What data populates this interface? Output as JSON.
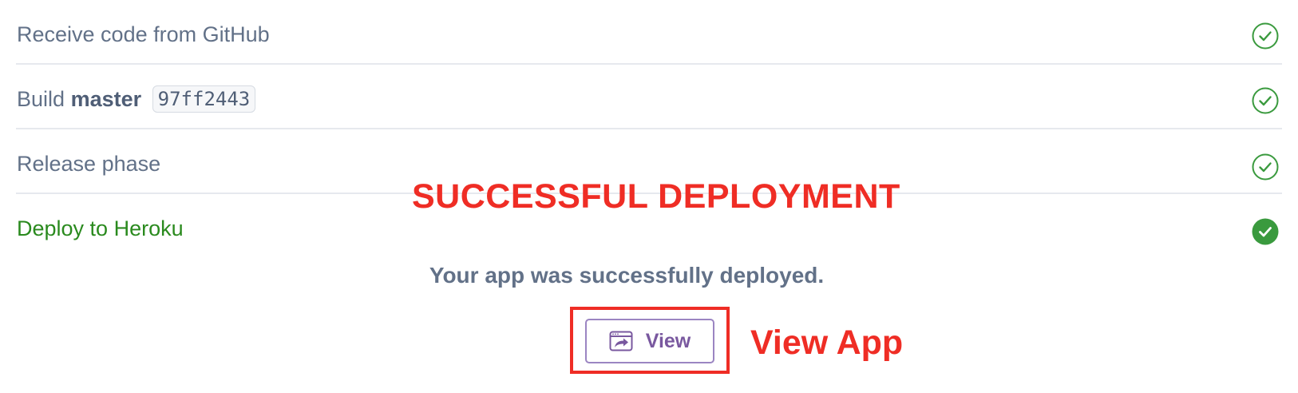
{
  "steps": [
    {
      "label": "Receive code from GitHub",
      "status": "complete",
      "status_icon": "check-circle-outline-icon"
    },
    {
      "label_prefix": "Build",
      "branch": "master",
      "commit": "97ff2443",
      "status": "complete",
      "status_icon": "check-circle-outline-icon"
    },
    {
      "label": "Release phase",
      "status": "complete",
      "status_icon": "check-circle-outline-icon"
    },
    {
      "label": "Deploy to Heroku",
      "status": "success",
      "status_icon": "check-circle-filled-icon"
    }
  ],
  "message": "Your app was successfully deployed.",
  "view_button": {
    "label": "View",
    "icon": "open-app-icon"
  },
  "annotations": {
    "title": "SUCCESSFUL DEPLOYMENT",
    "side_label": "View App"
  },
  "colors": {
    "success_green": "#2a8a1e",
    "muted_text": "#627188",
    "accent_purple": "#79589f",
    "annotation_red": "#ef2d25"
  }
}
